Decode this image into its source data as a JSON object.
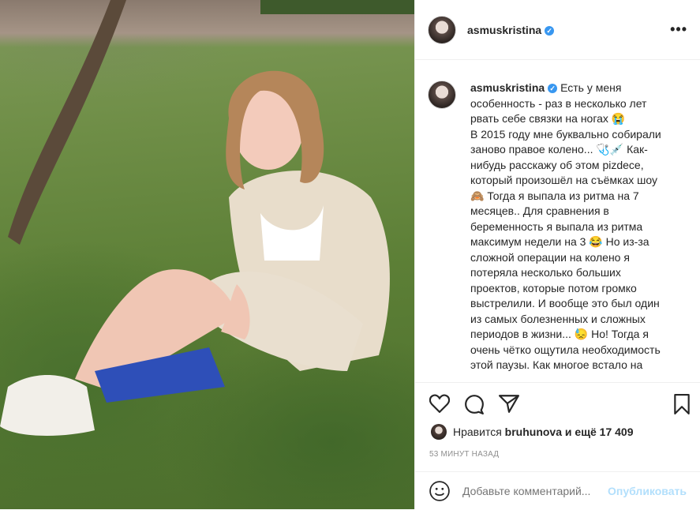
{
  "post": {
    "username": "asmuskristina",
    "verified_mark": "✓",
    "more_label": "•••",
    "caption_lines": [
      "Есть у меня",
      "особенность - раз в несколько лет",
      "рвать себе связки на ногах 😭",
      "В 2015 году мне буквально собирали",
      "заново правое колено... 🩺💉 Как-",
      "нибудь расскажу об этом pizdece,",
      "который произошёл на съёмках шоу",
      "🙈 Тогда я выпала из ритма на 7",
      "месяцев.. Для сравнения в",
      "беременность я выпала из ритма",
      "максимум недели на 3 😂 Но из-за",
      "сложной операции на колено я",
      "потеряла несколько больших",
      "проектов, которые потом громко",
      "выстрелили. И вообще это был один",
      "из самых болезненных и сложных",
      "периодов в жизни... 😓 Но! Тогда я",
      "очень чётко ощутила необходимость",
      "этой паузы. Как многое встало на"
    ],
    "likes_prefix": "Нравится",
    "likes_user": "bruhunova",
    "likes_suffix": "и ещё 17 409",
    "timestamp": "53 МИНУТ НАЗАД",
    "comment_placeholder": "Добавьте комментарий...",
    "post_button": "Опубликовать"
  },
  "icons": {
    "like": "heart-icon",
    "comment": "comment-icon",
    "share": "share-icon",
    "save": "bookmark-icon",
    "emoji": "smiley-icon"
  }
}
